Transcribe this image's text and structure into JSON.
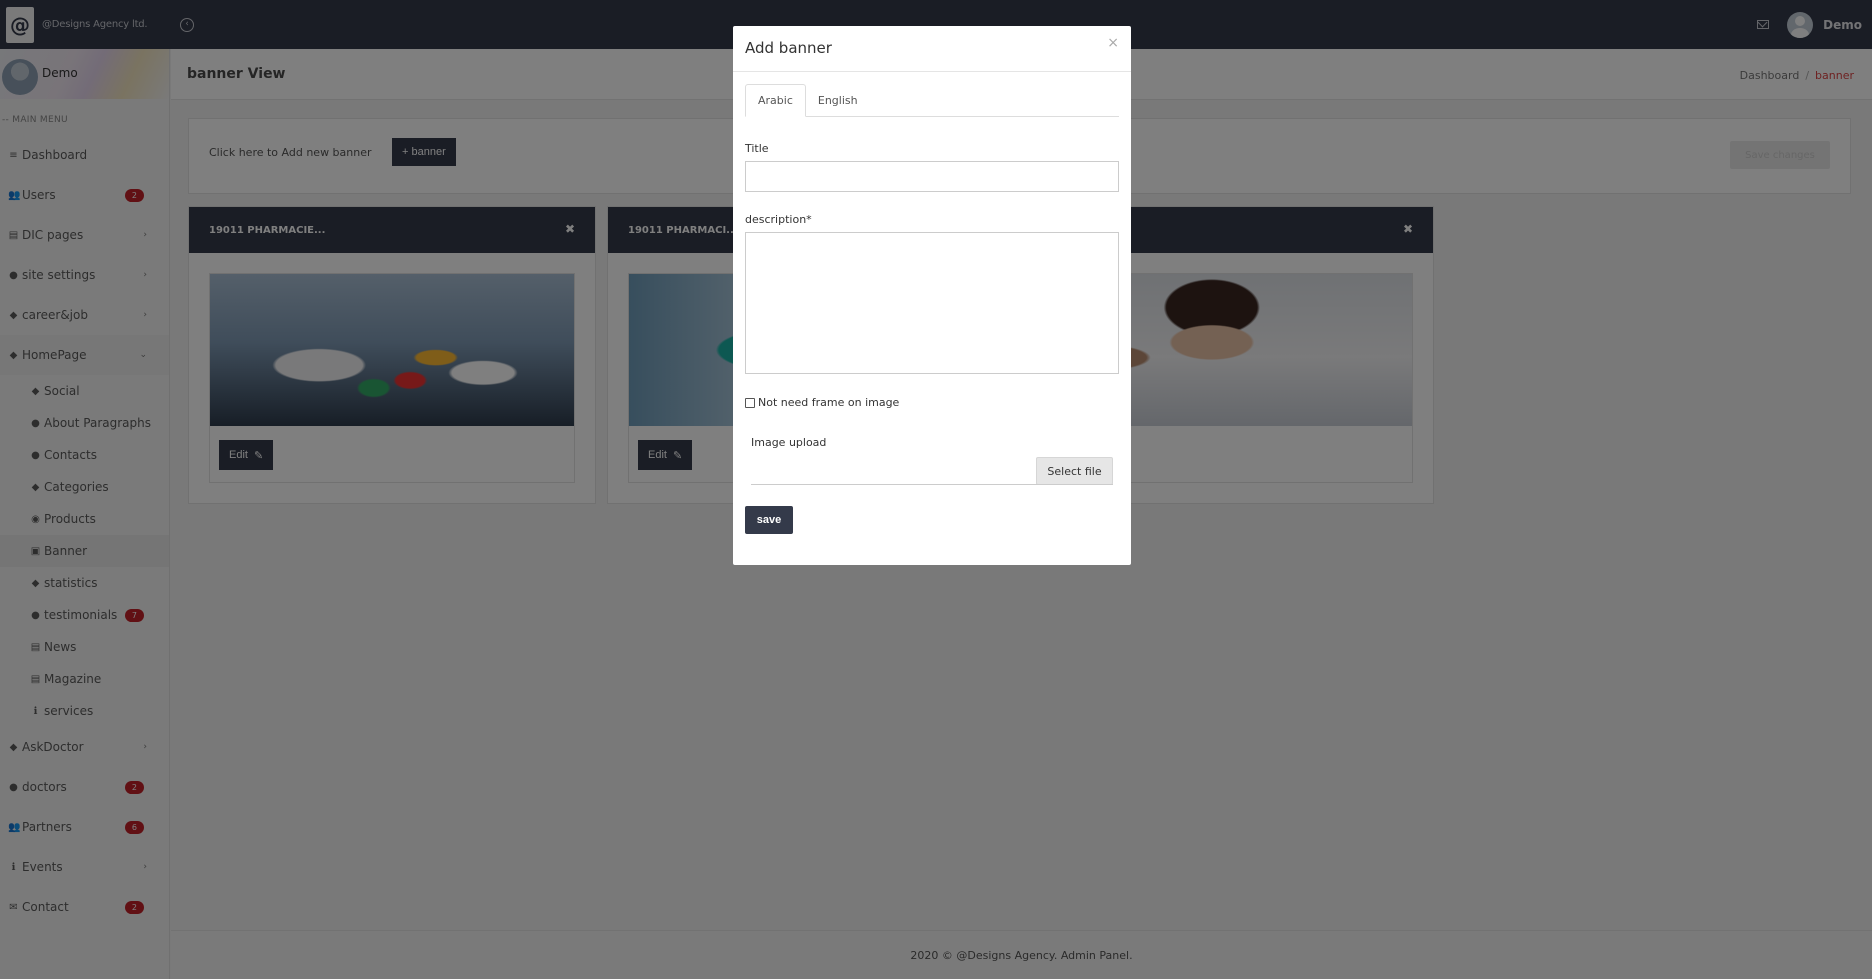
{
  "topbar": {
    "brand_name": "@Designs Agency ltd.",
    "logo_glyph": "@",
    "user_name": "Demo"
  },
  "sidebar": {
    "profile_name": "Demo",
    "menu_header": "-- MAIN MENU",
    "items": [
      {
        "label": "Dashboard",
        "icon": "list-icon",
        "glyph": "≡"
      },
      {
        "label": "Users",
        "icon": "users-icon",
        "glyph": "👥",
        "badge": "2"
      },
      {
        "label": "DIC pages",
        "icon": "id-card-icon",
        "glyph": "▤"
      },
      {
        "label": "site settings",
        "icon": "circle-icon",
        "glyph": "●"
      },
      {
        "label": "career&job",
        "icon": "tag-icon",
        "glyph": "◆"
      },
      {
        "label": "HomePage",
        "icon": "tag-icon",
        "glyph": "◆"
      }
    ],
    "subitems": [
      {
        "label": "Social",
        "icon": "tag-icon",
        "glyph": "◆"
      },
      {
        "label": "About Paragraphs",
        "icon": "circle-icon",
        "glyph": "●"
      },
      {
        "label": "Contacts",
        "icon": "circle-icon",
        "glyph": "●"
      },
      {
        "label": "Categories",
        "icon": "tag-icon",
        "glyph": "◆"
      },
      {
        "label": "Products",
        "icon": "product-icon",
        "glyph": "◉"
      },
      {
        "label": "Banner",
        "icon": "image-icon",
        "glyph": "▣"
      },
      {
        "label": "statistics",
        "icon": "tag-icon",
        "glyph": "◆"
      },
      {
        "label": "testimonials",
        "icon": "circle-icon",
        "glyph": "●",
        "badge": "7"
      },
      {
        "label": "News",
        "icon": "newspaper-icon",
        "glyph": "▤"
      },
      {
        "label": "Magazine",
        "icon": "newspaper-icon",
        "glyph": "▤"
      },
      {
        "label": "services",
        "icon": "info-icon",
        "glyph": "ℹ"
      }
    ],
    "bottom_items": [
      {
        "label": "AskDoctor",
        "icon": "tag-icon",
        "glyph": "◆"
      },
      {
        "label": "doctors",
        "icon": "circle-icon",
        "glyph": "●",
        "badge": "2"
      },
      {
        "label": "Partners",
        "icon": "users-icon",
        "glyph": "👥",
        "badge": "6"
      },
      {
        "label": "Events",
        "icon": "info-icon",
        "glyph": "ℹ"
      },
      {
        "label": "Contact",
        "icon": "envelope-icon",
        "glyph": "✉",
        "badge": "2"
      }
    ]
  },
  "page": {
    "title": "banner View",
    "breadcrumb_home": "Dashboard",
    "breadcrumb_sep": "/",
    "breadcrumb_current": "banner",
    "add_text": "Click here to Add new banner",
    "add_button": "+ banner",
    "save_changes": "Save changes"
  },
  "cards": [
    {
      "title": "19011 PHARMACIE...",
      "edit": "Edit",
      "image": "pills"
    },
    {
      "title": "19011 PHARMACI...",
      "edit": "Edit",
      "image": "medical"
    },
    {
      "title": "",
      "edit": "",
      "image": "call-center"
    }
  ],
  "footer": {
    "text": "2020 © @Designs Agency. Admin Panel."
  },
  "modal": {
    "title": "Add banner",
    "close": "×",
    "tabs": [
      "Arabic",
      "English"
    ],
    "title_label": "Title",
    "title_value": "",
    "description_label": "description*",
    "description_value": "",
    "checkbox_label": "Not need frame on image",
    "upload_label": "Image upload",
    "select_file": "Select file",
    "save": "save"
  },
  "colors": {
    "navbar": "#343a4a",
    "badge": "#c32028",
    "breadcrumb_active": "#dd4444",
    "overlay": "rgba(0,0,0,0.5)"
  }
}
